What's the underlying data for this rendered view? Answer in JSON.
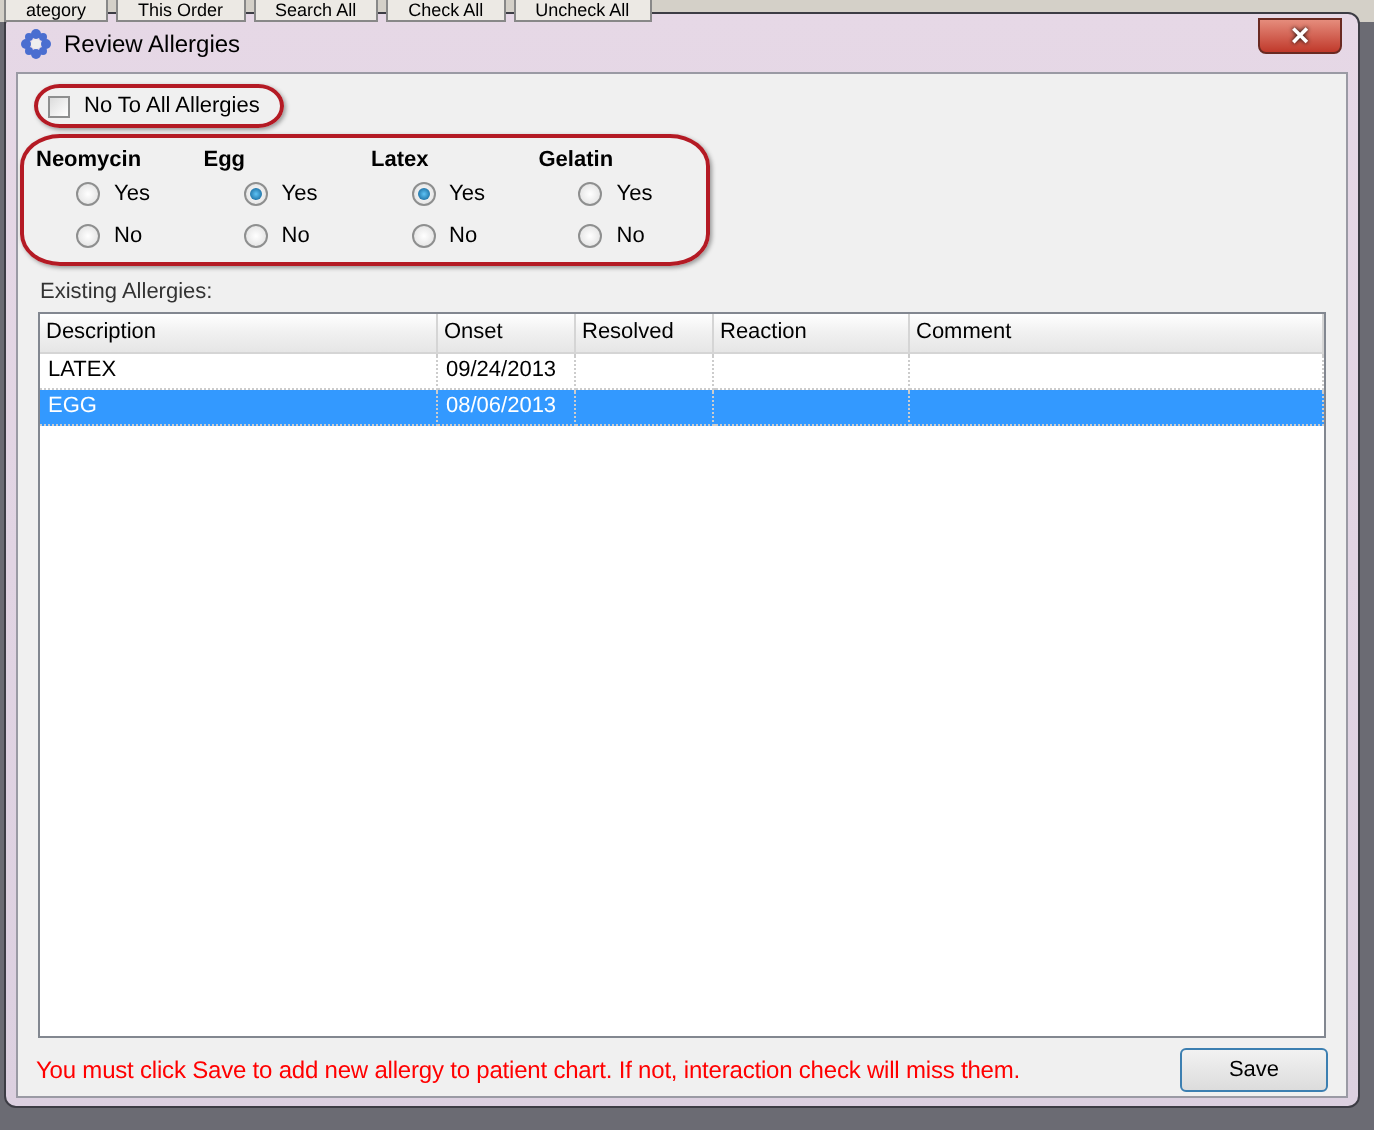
{
  "background_toolbar": [
    "ategory",
    "This Order",
    "Search All",
    "Check All",
    "Uncheck All"
  ],
  "window": {
    "title": "Review Allergies",
    "close": "×"
  },
  "no_to_all": {
    "label": "No To All Allergies",
    "checked": false
  },
  "allergies": [
    {
      "name": "Neomycin",
      "options": [
        {
          "label": "Yes",
          "selected": false
        },
        {
          "label": "No",
          "selected": false
        }
      ]
    },
    {
      "name": "Egg",
      "options": [
        {
          "label": "Yes",
          "selected": true
        },
        {
          "label": "No",
          "selected": false
        }
      ]
    },
    {
      "name": "Latex",
      "options": [
        {
          "label": "Yes",
          "selected": true
        },
        {
          "label": "No",
          "selected": false
        }
      ]
    },
    {
      "name": "Gelatin",
      "options": [
        {
          "label": "Yes",
          "selected": false
        },
        {
          "label": "No",
          "selected": false
        }
      ]
    }
  ],
  "existing_label": "Existing Allergies:",
  "table": {
    "columns": [
      "Description",
      "Onset",
      "Resolved",
      "Reaction",
      "Comment"
    ],
    "rows": [
      {
        "cells": [
          "LATEX",
          "09/24/2013",
          "",
          "",
          ""
        ],
        "selected": false
      },
      {
        "cells": [
          "EGG",
          "08/06/2013",
          "",
          "",
          ""
        ],
        "selected": true
      }
    ]
  },
  "warning": "You must click Save to add new allergy to patient chart. If not, interaction check will miss them.",
  "buttons": [
    "Save"
  ]
}
